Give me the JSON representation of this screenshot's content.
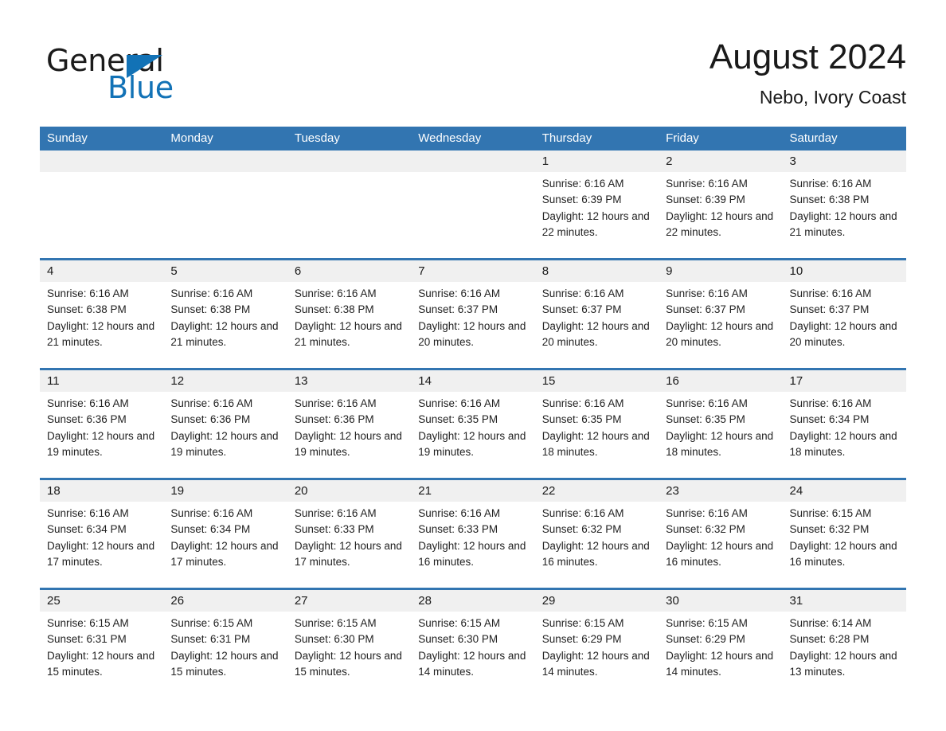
{
  "brand": {
    "name_part1": "General",
    "name_part2": "Blue",
    "accent_color": "#1272b6"
  },
  "header": {
    "month_title": "August 2024",
    "location": "Nebo, Ivory Coast"
  },
  "theme": {
    "header_blue": "#3275b1",
    "day_band_gray": "#f0f0f0",
    "text_color": "#1a1a1a"
  },
  "weekdays": [
    "Sunday",
    "Monday",
    "Tuesday",
    "Wednesday",
    "Thursday",
    "Friday",
    "Saturday"
  ],
  "weeks": [
    [
      {
        "day": "",
        "empty": true
      },
      {
        "day": "",
        "empty": true
      },
      {
        "day": "",
        "empty": true
      },
      {
        "day": "",
        "empty": true
      },
      {
        "day": "1",
        "sunrise": "Sunrise: 6:16 AM",
        "sunset": "Sunset: 6:39 PM",
        "daylight": "Daylight: 12 hours and 22 minutes."
      },
      {
        "day": "2",
        "sunrise": "Sunrise: 6:16 AM",
        "sunset": "Sunset: 6:39 PM",
        "daylight": "Daylight: 12 hours and 22 minutes."
      },
      {
        "day": "3",
        "sunrise": "Sunrise: 6:16 AM",
        "sunset": "Sunset: 6:38 PM",
        "daylight": "Daylight: 12 hours and 21 minutes."
      }
    ],
    [
      {
        "day": "4",
        "sunrise": "Sunrise: 6:16 AM",
        "sunset": "Sunset: 6:38 PM",
        "daylight": "Daylight: 12 hours and 21 minutes."
      },
      {
        "day": "5",
        "sunrise": "Sunrise: 6:16 AM",
        "sunset": "Sunset: 6:38 PM",
        "daylight": "Daylight: 12 hours and 21 minutes."
      },
      {
        "day": "6",
        "sunrise": "Sunrise: 6:16 AM",
        "sunset": "Sunset: 6:38 PM",
        "daylight": "Daylight: 12 hours and 21 minutes."
      },
      {
        "day": "7",
        "sunrise": "Sunrise: 6:16 AM",
        "sunset": "Sunset: 6:37 PM",
        "daylight": "Daylight: 12 hours and 20 minutes."
      },
      {
        "day": "8",
        "sunrise": "Sunrise: 6:16 AM",
        "sunset": "Sunset: 6:37 PM",
        "daylight": "Daylight: 12 hours and 20 minutes."
      },
      {
        "day": "9",
        "sunrise": "Sunrise: 6:16 AM",
        "sunset": "Sunset: 6:37 PM",
        "daylight": "Daylight: 12 hours and 20 minutes."
      },
      {
        "day": "10",
        "sunrise": "Sunrise: 6:16 AM",
        "sunset": "Sunset: 6:37 PM",
        "daylight": "Daylight: 12 hours and 20 minutes."
      }
    ],
    [
      {
        "day": "11",
        "sunrise": "Sunrise: 6:16 AM",
        "sunset": "Sunset: 6:36 PM",
        "daylight": "Daylight: 12 hours and 19 minutes."
      },
      {
        "day": "12",
        "sunrise": "Sunrise: 6:16 AM",
        "sunset": "Sunset: 6:36 PM",
        "daylight": "Daylight: 12 hours and 19 minutes."
      },
      {
        "day": "13",
        "sunrise": "Sunrise: 6:16 AM",
        "sunset": "Sunset: 6:36 PM",
        "daylight": "Daylight: 12 hours and 19 minutes."
      },
      {
        "day": "14",
        "sunrise": "Sunrise: 6:16 AM",
        "sunset": "Sunset: 6:35 PM",
        "daylight": "Daylight: 12 hours and 19 minutes."
      },
      {
        "day": "15",
        "sunrise": "Sunrise: 6:16 AM",
        "sunset": "Sunset: 6:35 PM",
        "daylight": "Daylight: 12 hours and 18 minutes."
      },
      {
        "day": "16",
        "sunrise": "Sunrise: 6:16 AM",
        "sunset": "Sunset: 6:35 PM",
        "daylight": "Daylight: 12 hours and 18 minutes."
      },
      {
        "day": "17",
        "sunrise": "Sunrise: 6:16 AM",
        "sunset": "Sunset: 6:34 PM",
        "daylight": "Daylight: 12 hours and 18 minutes."
      }
    ],
    [
      {
        "day": "18",
        "sunrise": "Sunrise: 6:16 AM",
        "sunset": "Sunset: 6:34 PM",
        "daylight": "Daylight: 12 hours and 17 minutes."
      },
      {
        "day": "19",
        "sunrise": "Sunrise: 6:16 AM",
        "sunset": "Sunset: 6:34 PM",
        "daylight": "Daylight: 12 hours and 17 minutes."
      },
      {
        "day": "20",
        "sunrise": "Sunrise: 6:16 AM",
        "sunset": "Sunset: 6:33 PM",
        "daylight": "Daylight: 12 hours and 17 minutes."
      },
      {
        "day": "21",
        "sunrise": "Sunrise: 6:16 AM",
        "sunset": "Sunset: 6:33 PM",
        "daylight": "Daylight: 12 hours and 16 minutes."
      },
      {
        "day": "22",
        "sunrise": "Sunrise: 6:16 AM",
        "sunset": "Sunset: 6:32 PM",
        "daylight": "Daylight: 12 hours and 16 minutes."
      },
      {
        "day": "23",
        "sunrise": "Sunrise: 6:16 AM",
        "sunset": "Sunset: 6:32 PM",
        "daylight": "Daylight: 12 hours and 16 minutes."
      },
      {
        "day": "24",
        "sunrise": "Sunrise: 6:15 AM",
        "sunset": "Sunset: 6:32 PM",
        "daylight": "Daylight: 12 hours and 16 minutes."
      }
    ],
    [
      {
        "day": "25",
        "sunrise": "Sunrise: 6:15 AM",
        "sunset": "Sunset: 6:31 PM",
        "daylight": "Daylight: 12 hours and 15 minutes."
      },
      {
        "day": "26",
        "sunrise": "Sunrise: 6:15 AM",
        "sunset": "Sunset: 6:31 PM",
        "daylight": "Daylight: 12 hours and 15 minutes."
      },
      {
        "day": "27",
        "sunrise": "Sunrise: 6:15 AM",
        "sunset": "Sunset: 6:30 PM",
        "daylight": "Daylight: 12 hours and 15 minutes."
      },
      {
        "day": "28",
        "sunrise": "Sunrise: 6:15 AM",
        "sunset": "Sunset: 6:30 PM",
        "daylight": "Daylight: 12 hours and 14 minutes."
      },
      {
        "day": "29",
        "sunrise": "Sunrise: 6:15 AM",
        "sunset": "Sunset: 6:29 PM",
        "daylight": "Daylight: 12 hours and 14 minutes."
      },
      {
        "day": "30",
        "sunrise": "Sunrise: 6:15 AM",
        "sunset": "Sunset: 6:29 PM",
        "daylight": "Daylight: 12 hours and 14 minutes."
      },
      {
        "day": "31",
        "sunrise": "Sunrise: 6:14 AM",
        "sunset": "Sunset: 6:28 PM",
        "daylight": "Daylight: 12 hours and 13 minutes."
      }
    ]
  ]
}
